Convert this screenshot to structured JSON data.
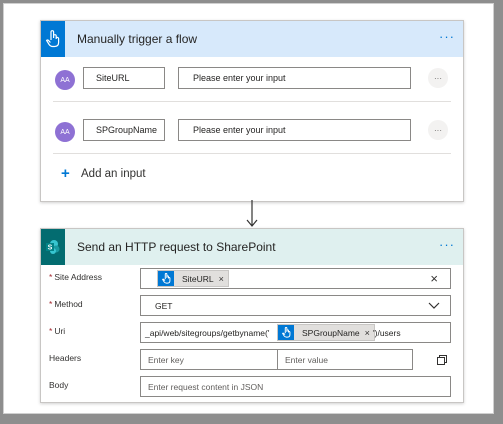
{
  "trigger": {
    "title": "Manually trigger a flow",
    "more": "···",
    "inputs": [
      {
        "avatar": "AA",
        "key": "SiteURL",
        "value": "Please enter your input",
        "more": "···"
      },
      {
        "avatar": "AA",
        "key": "SPGroupName",
        "value": "Please enter your input",
        "more": "···"
      }
    ],
    "add_plus": "+",
    "add_label": "Add an input"
  },
  "action": {
    "title": "Send an HTTP request to SharePoint",
    "more": "···",
    "site_address": {
      "label": "Site Address",
      "required": "*",
      "token": "SiteURL",
      "token_x": "×",
      "clear": "×"
    },
    "method": {
      "label": "Method",
      "required": "*",
      "value": "GET"
    },
    "uri": {
      "label": "Uri",
      "required": "*",
      "prefix": "_api/web/sitegroups/getbyname('",
      "token": "SPGroupName",
      "token_x": "×",
      "suffix": "')/users"
    },
    "headers": {
      "label": "Headers",
      "key_placeholder": "Enter key",
      "value_placeholder": "Enter value"
    },
    "body": {
      "label": "Body",
      "placeholder": "Enter request content in JSON"
    }
  },
  "colors": {
    "trigger_header": "#d7e9fb",
    "trigger_icon": "#0078d4",
    "action_header": "#dff0ef",
    "action_icon": "#036c70",
    "token_icon": "#0078d4",
    "avatar": "#8e71d4"
  },
  "icons": {
    "trigger": "hand-touch-icon",
    "action": "sharepoint-icon",
    "arrow": "arrow-down-icon",
    "copy": "copy-icon"
  }
}
